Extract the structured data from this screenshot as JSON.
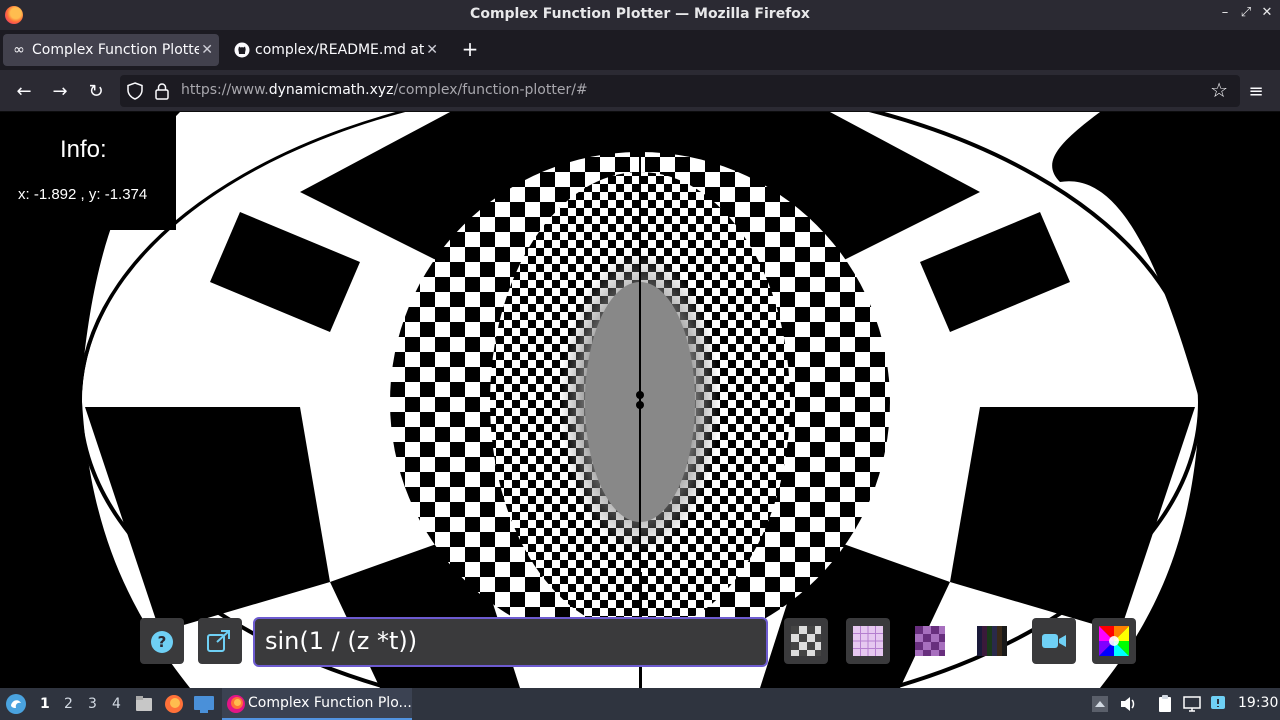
{
  "window": {
    "title": "Complex Function Plotter — Mozilla Firefox"
  },
  "tabs": [
    {
      "label": "Complex Function Plotter",
      "active": true,
      "icon": "infinity-icon"
    },
    {
      "label": "complex/README.md at",
      "active": false,
      "icon": "github-icon"
    }
  ],
  "navbar": {
    "url_prefix": "https://www.",
    "url_host": "dynamicmath.xyz",
    "url_path": "/complex/function-plotter/#"
  },
  "info": {
    "title": "Info:",
    "coords": "x: -1.892 , y: -1.374"
  },
  "toolbar": {
    "function": "sin(1 / (z *t))",
    "buttons": [
      "help-icon",
      "open-external-icon",
      "texture-checker-icon",
      "texture-grid-icon",
      "texture-pattern-icon",
      "texture-stripes-icon",
      "video-camera-icon",
      "color-wheel-icon"
    ]
  },
  "taskbar": {
    "workspaces": [
      "1",
      "2",
      "3",
      "4"
    ],
    "active_workspace": "1",
    "window_label": "Complex Function Plo...",
    "clock": "19:30"
  },
  "colors": {
    "accent": "#6d5bd0",
    "firefox_chrome": "#2b2a33"
  }
}
